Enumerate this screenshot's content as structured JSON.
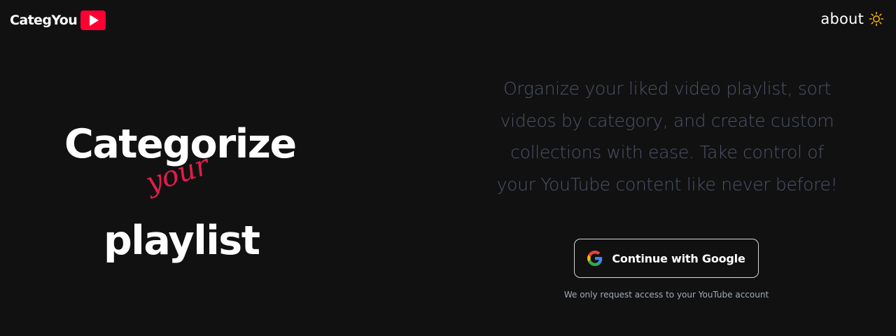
{
  "header": {
    "logo_text": "CategYou",
    "logo_icon": "youtube-play-icon",
    "about_label": "about",
    "theme_icon": "sun-icon"
  },
  "hero": {
    "line1": "Categorize",
    "line2": "your",
    "line3": "playlist"
  },
  "main": {
    "tagline": "Organize your liked video playlist, sort videos by category, and create custom collections with ease. Take control of your YouTube content like never before!",
    "google_button_label": "Continue with Google",
    "google_icon": "google-icon",
    "access_note": "We only request access to your YouTube account"
  },
  "colors": {
    "background": "#111112",
    "accent_red": "#e11d48",
    "logo_red": "#ff0033",
    "tagline_gray": "#4d5466",
    "sun_yellow": "#f5b300"
  }
}
